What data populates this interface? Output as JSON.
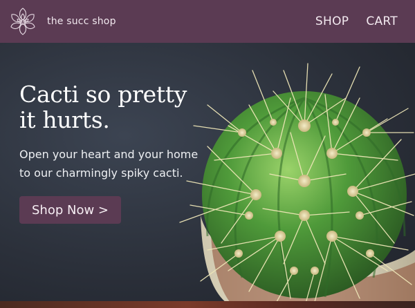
{
  "header": {
    "brand": "the succ shop",
    "logo_icon": "succulent-logo-icon",
    "nav": [
      {
        "label": "SHOP"
      },
      {
        "label": "CART"
      }
    ]
  },
  "hero": {
    "headline": "Cacti so pretty it hurts.",
    "subtext": "Open your heart and your home to our charmingly spiky cacti.",
    "cta_label": "Shop Now >",
    "image": "potted-cactus-photo"
  },
  "colors": {
    "brand_purple": "#5b3b53",
    "hero_background": "#2b303a",
    "cactus_green": "#4f9a3a",
    "spine_cream": "#efe7b8"
  }
}
